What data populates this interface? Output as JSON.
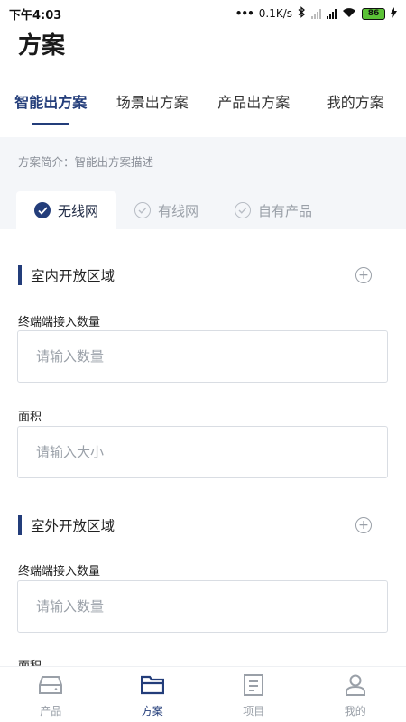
{
  "status": {
    "time": "下午4:03",
    "network_speed": "0.1K/s",
    "battery": "86"
  },
  "title": "方案",
  "tabs": [
    {
      "label": "智能出方案",
      "active": true
    },
    {
      "label": "场景出方案",
      "active": false
    },
    {
      "label": "产品出方案",
      "active": false
    },
    {
      "label": "我的方案",
      "active": false
    }
  ],
  "description": "方案简介：智能出方案描述",
  "subtabs": [
    {
      "label": "无线网",
      "active": true
    },
    {
      "label": "有线网",
      "active": false
    },
    {
      "label": "自有产品",
      "active": false
    }
  ],
  "sections": [
    {
      "title": "室内开放区域",
      "fields": [
        {
          "label": "终端端接入数量",
          "placeholder": "请输入数量"
        },
        {
          "label": "面积",
          "placeholder": "请输入大小"
        }
      ]
    },
    {
      "title": "室外开放区域",
      "fields": [
        {
          "label": "终端端接入数量",
          "placeholder": "请输入数量"
        },
        {
          "label": "面积",
          "placeholder": ""
        }
      ]
    }
  ],
  "bottom_nav": [
    {
      "label": "产品",
      "icon": "product-icon",
      "active": false
    },
    {
      "label": "方案",
      "icon": "folder-icon",
      "active": true
    },
    {
      "label": "项目",
      "icon": "document-icon",
      "active": false
    },
    {
      "label": "我的",
      "icon": "user-icon",
      "active": false
    }
  ],
  "colors": {
    "accent": "#233d7a",
    "panel_bg": "#f4f6f9",
    "muted": "#9aa0a8"
  }
}
